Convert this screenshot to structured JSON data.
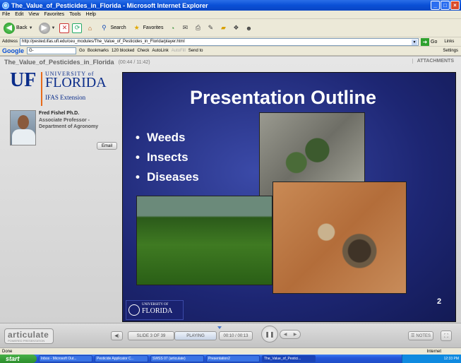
{
  "window": {
    "title": "The_Value_of_Pesticides_in_Florida - Microsoft Internet Explorer",
    "controls": [
      "_",
      "□",
      "×"
    ]
  },
  "menu": [
    "File",
    "Edit",
    "View",
    "Favorites",
    "Tools",
    "Help"
  ],
  "toolbar": {
    "back": "Back",
    "search": "Search",
    "favorites": "Favorites"
  },
  "address": {
    "label": "Address",
    "url": "http://pested.ifas.ufl.edu/ceu_modules/The_Value_of_Pesticides_in_Florida/player.html",
    "go": "Go",
    "links": "Links"
  },
  "googlebar": {
    "logo": "Google",
    "search_value": "G-",
    "go": "Go",
    "bookmarks": "Bookmarks",
    "blocked": "120 blocked",
    "check": "Check",
    "autolink": "AutoLink",
    "autofill": "AutoFill",
    "sendto": "Send to",
    "settings": "Settings"
  },
  "player": {
    "title": "The_Value_of_Pesticides_in_Florida",
    "time": "(00:44 / 11:42)",
    "attachments": "ATTACHMENTS",
    "logo": {
      "mark": "UF",
      "university": "UNIVERSITY of",
      "florida": "FLORIDA",
      "ifas": "IFAS Extension"
    },
    "presenter": {
      "name": "Fred Fishel Ph.D.",
      "role": "Associate Professor - Department of Agronomy",
      "email": "Email"
    },
    "slide": {
      "title": "Presentation Outline",
      "bullets": [
        "Weeds",
        "Insects",
        "Diseases"
      ],
      "logo_univ": "UNIVERSITY OF",
      "logo_florida": "FLORIDA",
      "number": "2"
    },
    "controls": {
      "brand": "articulate",
      "brand_sub": "POWERED PRESENTATION",
      "slide_count": "SLIDE 3 OF 39",
      "status": "PLAYING",
      "timecode": "00:10 / 00:13",
      "notes": "NOTES"
    }
  },
  "status": {
    "text": "Done",
    "zone": "Internet"
  },
  "taskbar": {
    "start": "start",
    "tasks": [
      "Inbox - Microsoft Out...",
      "Pesticide Applicator C...",
      "SWSS 07 (articulate)",
      "Presentation2",
      "The_Value_of_Pestici..."
    ],
    "clock": "12:33 PM"
  }
}
